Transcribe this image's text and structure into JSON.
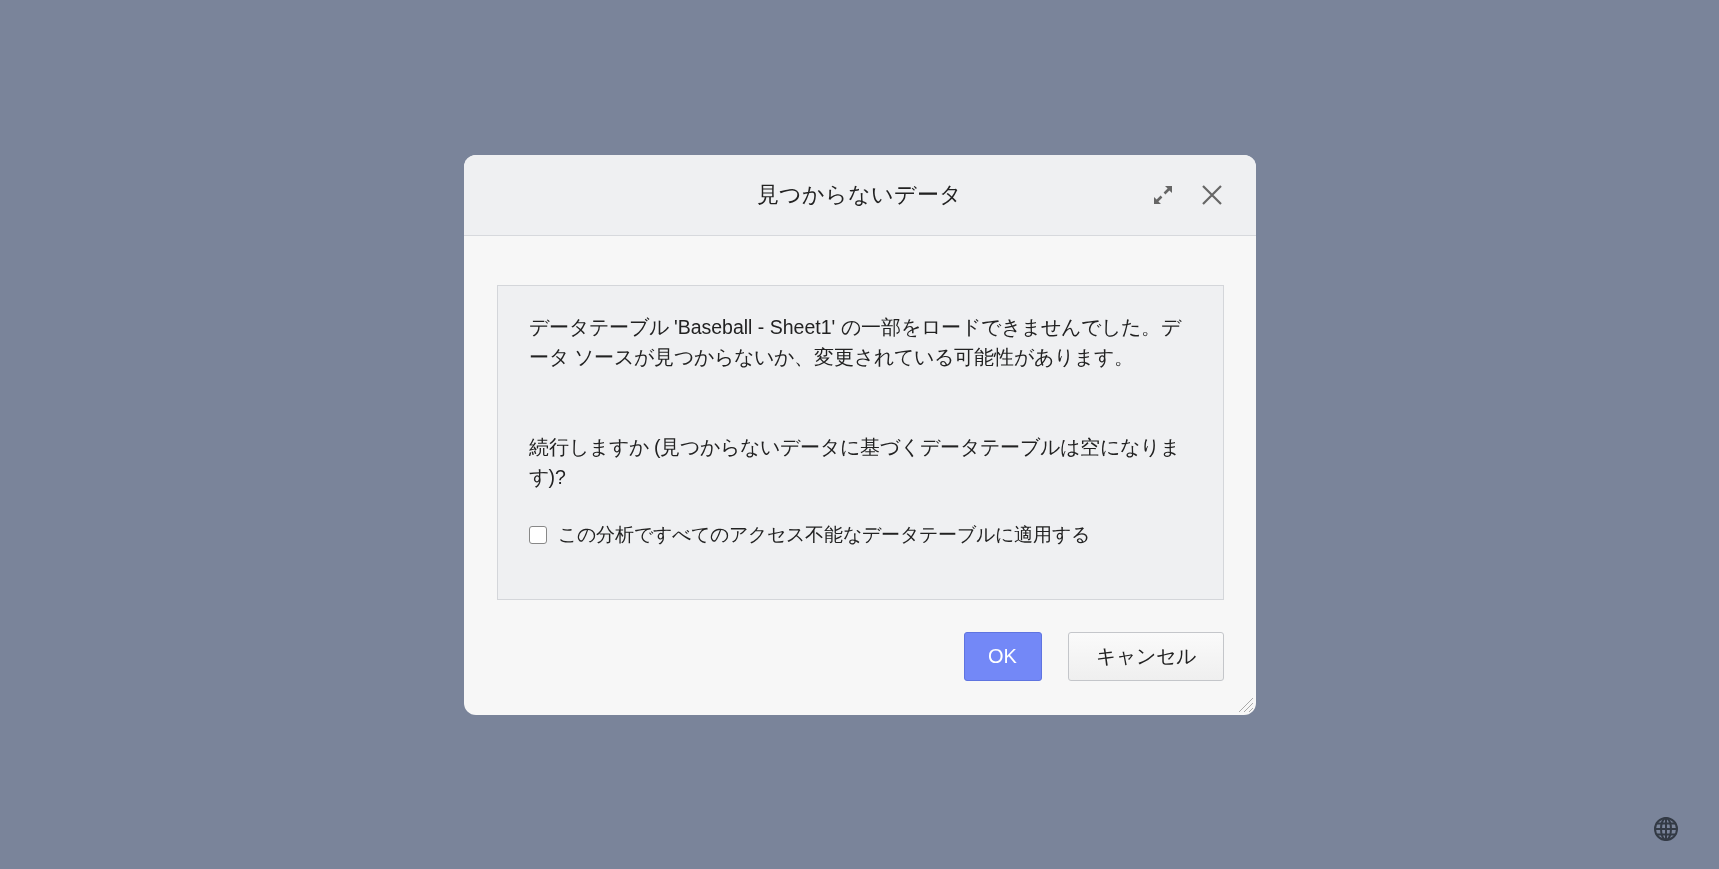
{
  "dialog": {
    "title": "見つからないデータ",
    "paragraphs": [
      "データテーブル 'Baseball - Sheet1' の一部をロードできませんでした。データ ソースが見つからないか、変更されている可能性があります。",
      "続行しますか (見つからないデータに基づくデータテーブルは空になります)?"
    ],
    "checkbox": {
      "label": "この分析ですべてのアクセス不能なデータテーブルに適用する",
      "checked": false
    },
    "buttons": [
      {
        "label": "OK",
        "kind": "primary"
      },
      {
        "label": "キャンセル",
        "kind": "secondary"
      }
    ]
  }
}
